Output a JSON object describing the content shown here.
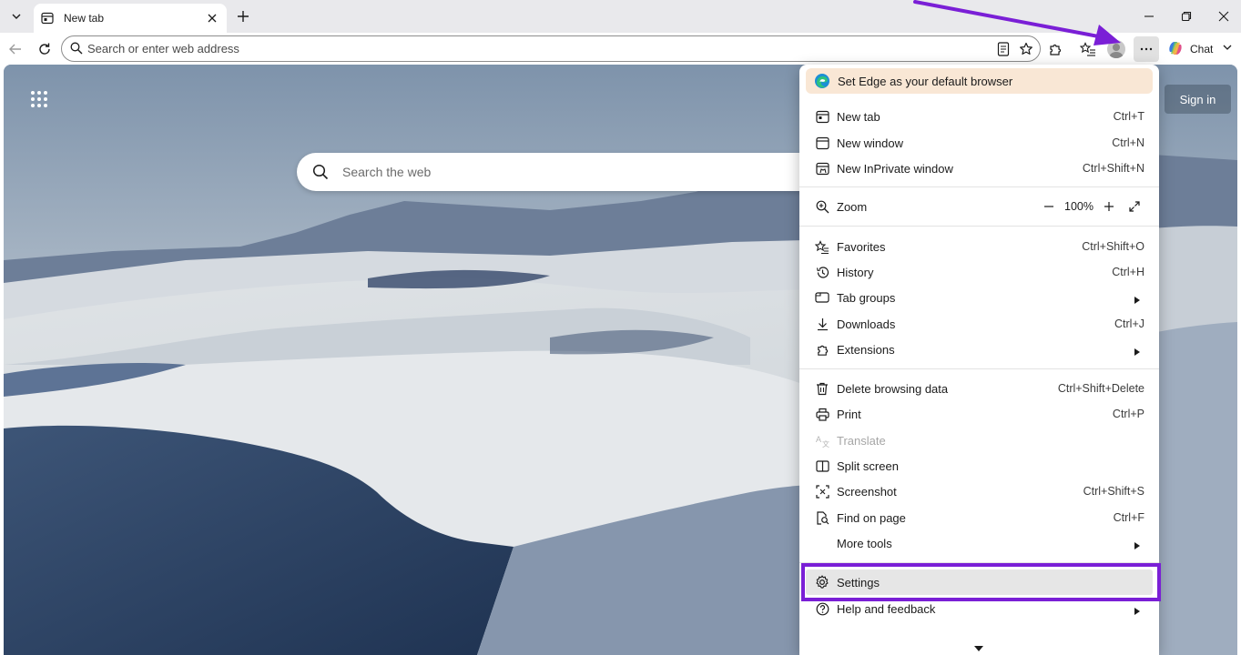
{
  "tabs": [
    {
      "title": "New tab"
    }
  ],
  "omnibox": {
    "placeholder": "Search or enter web address"
  },
  "toolbar": {
    "chat_label": "Chat"
  },
  "page": {
    "search_placeholder": "Search the web",
    "sign_in_label": "Sign in"
  },
  "menu": {
    "banner": "Set Edge as your default browser",
    "items": [
      {
        "label": "New tab",
        "shortcut": "Ctrl+T"
      },
      {
        "label": "New window",
        "shortcut": "Ctrl+N"
      },
      {
        "label": "New InPrivate window",
        "shortcut": "Ctrl+Shift+N"
      },
      {
        "label": "Zoom",
        "zoom_value": "100%"
      },
      {
        "label": "Favorites",
        "shortcut": "Ctrl+Shift+O"
      },
      {
        "label": "History",
        "shortcut": "Ctrl+H"
      },
      {
        "label": "Tab groups",
        "submenu": true
      },
      {
        "label": "Downloads",
        "shortcut": "Ctrl+J"
      },
      {
        "label": "Extensions",
        "submenu": true
      },
      {
        "label": "Delete browsing data",
        "shortcut": "Ctrl+Shift+Delete"
      },
      {
        "label": "Print",
        "shortcut": "Ctrl+P"
      },
      {
        "label": "Translate",
        "disabled": true
      },
      {
        "label": "Split screen"
      },
      {
        "label": "Screenshot",
        "shortcut": "Ctrl+Shift+S"
      },
      {
        "label": "Find on page",
        "shortcut": "Ctrl+F"
      },
      {
        "label": "More tools",
        "submenu": true
      },
      {
        "label": "Settings",
        "highlighted": true
      },
      {
        "label": "Help and feedback",
        "submenu": true
      }
    ]
  },
  "annotation": {
    "highlight_color": "#7a1fd6",
    "arrow_color": "#7a1fd6"
  }
}
